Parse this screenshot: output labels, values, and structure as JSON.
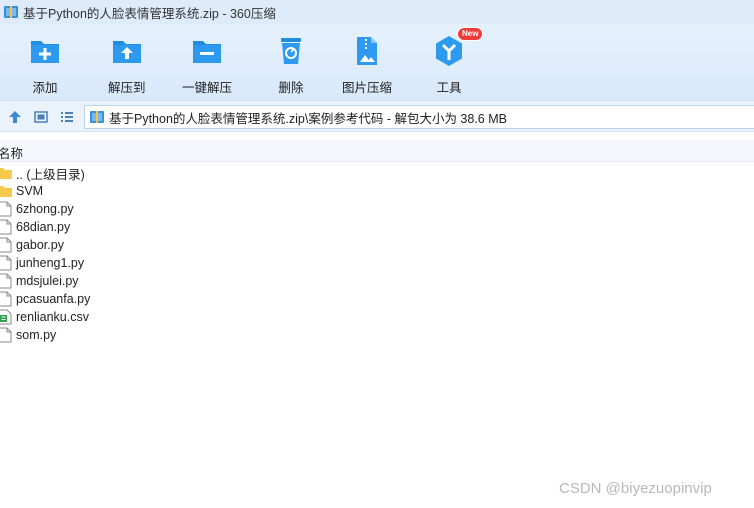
{
  "window": {
    "title": "基于Python的人脸表情管理系统.zip - 360压缩"
  },
  "toolbar": {
    "buttons": [
      {
        "label": "添加",
        "icon": "add-icon"
      },
      {
        "label": "解压到",
        "icon": "extract-to-icon"
      },
      {
        "label": "一键解压",
        "icon": "one-click-extract-icon"
      },
      {
        "label": "删除",
        "icon": "delete-icon"
      },
      {
        "label": "图片压缩",
        "icon": "image-compress-icon"
      },
      {
        "label": "工具",
        "icon": "tools-icon",
        "badge": "New"
      }
    ]
  },
  "address": {
    "path": "基于Python的人脸表情管理系统.zip\\案例参考代码 - 解包大小为 38.6 MB"
  },
  "columns": {
    "name": "名称"
  },
  "files": [
    {
      "name": ".. (上级目录)",
      "type": "folder"
    },
    {
      "name": "SVM",
      "type": "folder"
    },
    {
      "name": "6zhong.py",
      "type": "file"
    },
    {
      "name": "68dian.py",
      "type": "file"
    },
    {
      "name": "gabor.py",
      "type": "file"
    },
    {
      "name": "junheng1.py",
      "type": "file"
    },
    {
      "name": "mdsjulei.py",
      "type": "file"
    },
    {
      "name": "pcasuanfa.py",
      "type": "file"
    },
    {
      "name": "renlianku.csv",
      "type": "csv"
    },
    {
      "name": "som.py",
      "type": "file"
    }
  ],
  "watermark": "CSDN @biyezuopinvip",
  "colors": {
    "accent": "#1f8ee0",
    "titlebar": "#ddebfb",
    "toolbar": "#e2effc",
    "folder": "#f7c94b",
    "badge": "#f03b3b"
  }
}
